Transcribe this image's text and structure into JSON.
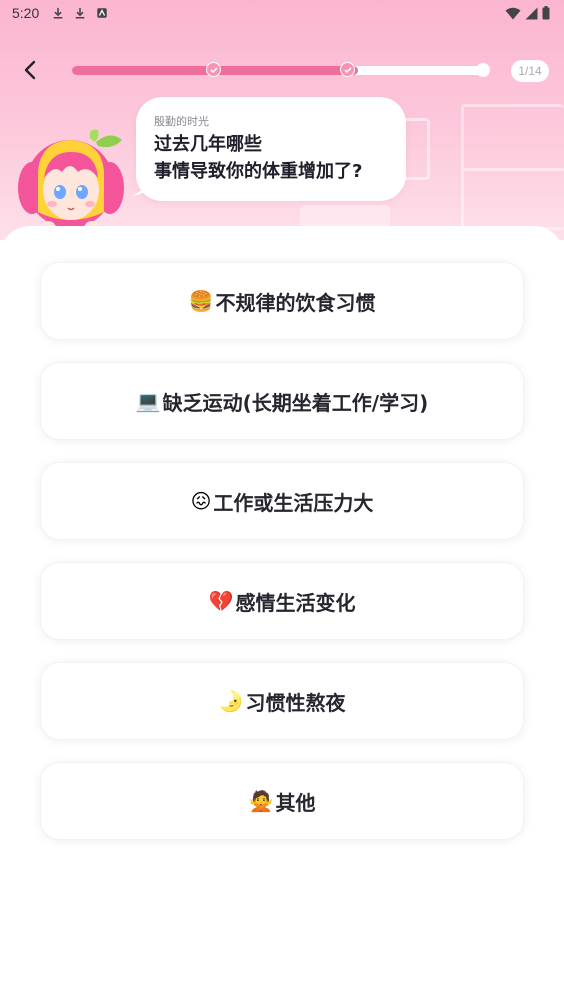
{
  "status_bar": {
    "time": "5:20"
  },
  "header": {
    "progress": {
      "current": 1,
      "total": 14,
      "label": "1/14",
      "fill_fraction": 0.69
    }
  },
  "question": {
    "sender": "殷勤的时光",
    "line1": "过去几年哪些",
    "line2": "事情导致你的体重增加了?"
  },
  "options": [
    {
      "emoji": "🍔",
      "text": "不规律的饮食习惯"
    },
    {
      "emoji": "💻",
      "text": "缺乏运动(长期坐着工作/学习)"
    },
    {
      "emoji": "😖",
      "text": "工作或生活压力大"
    },
    {
      "emoji": "💔",
      "text": "感情生活变化"
    },
    {
      "emoji": "🌛",
      "text": "习惯性熬夜"
    },
    {
      "emoji": "🙅",
      "text": "其他"
    }
  ],
  "colors": {
    "accent": "#ee6f9b",
    "header_bg": "#fbb6cf",
    "text": "#26262f"
  }
}
